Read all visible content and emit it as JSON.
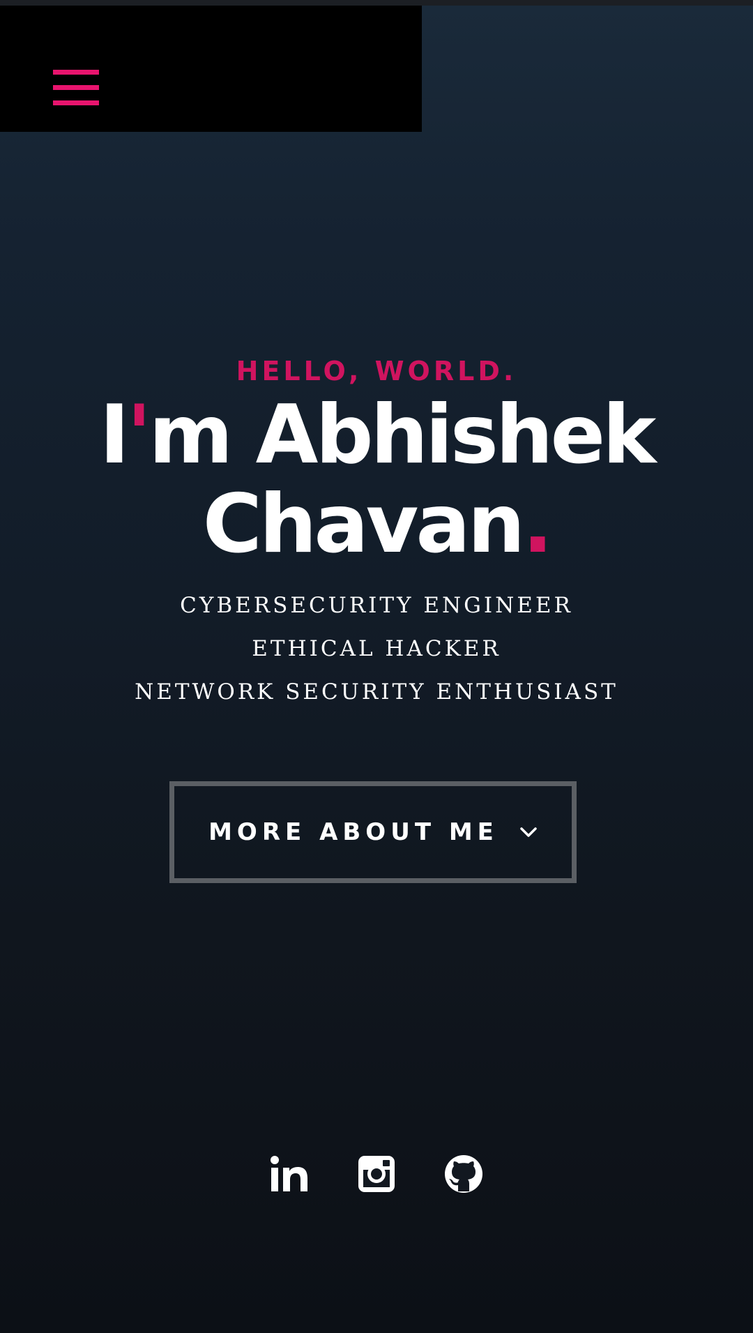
{
  "nav": {
    "menu_icon": "hamburger-menu-icon"
  },
  "hero": {
    "greeting": "HELLO, WORLD.",
    "name_line1_first": "I",
    "name_line1_apostrophe": "'",
    "name_line1_rest": "m Abhishek",
    "name_line2": "Chavan",
    "name_line2_dot": ".",
    "roles": [
      "CYBERSECURITY ENGINEER",
      "ETHICAL HACKER",
      "NETWORK SECURITY ENTHUSIAST"
    ],
    "cta_label": "MORE ABOUT ME",
    "cta_icon": "chevron-down-icon"
  },
  "social": [
    {
      "icon": "linkedin-icon"
    },
    {
      "icon": "instagram-icon"
    },
    {
      "icon": "github-icon"
    }
  ],
  "colors": {
    "accent": "#d0145f",
    "menu": "#e8146e",
    "text": "#ffffff",
    "button_border": "#5b5f64",
    "nav_bg": "#000000"
  }
}
